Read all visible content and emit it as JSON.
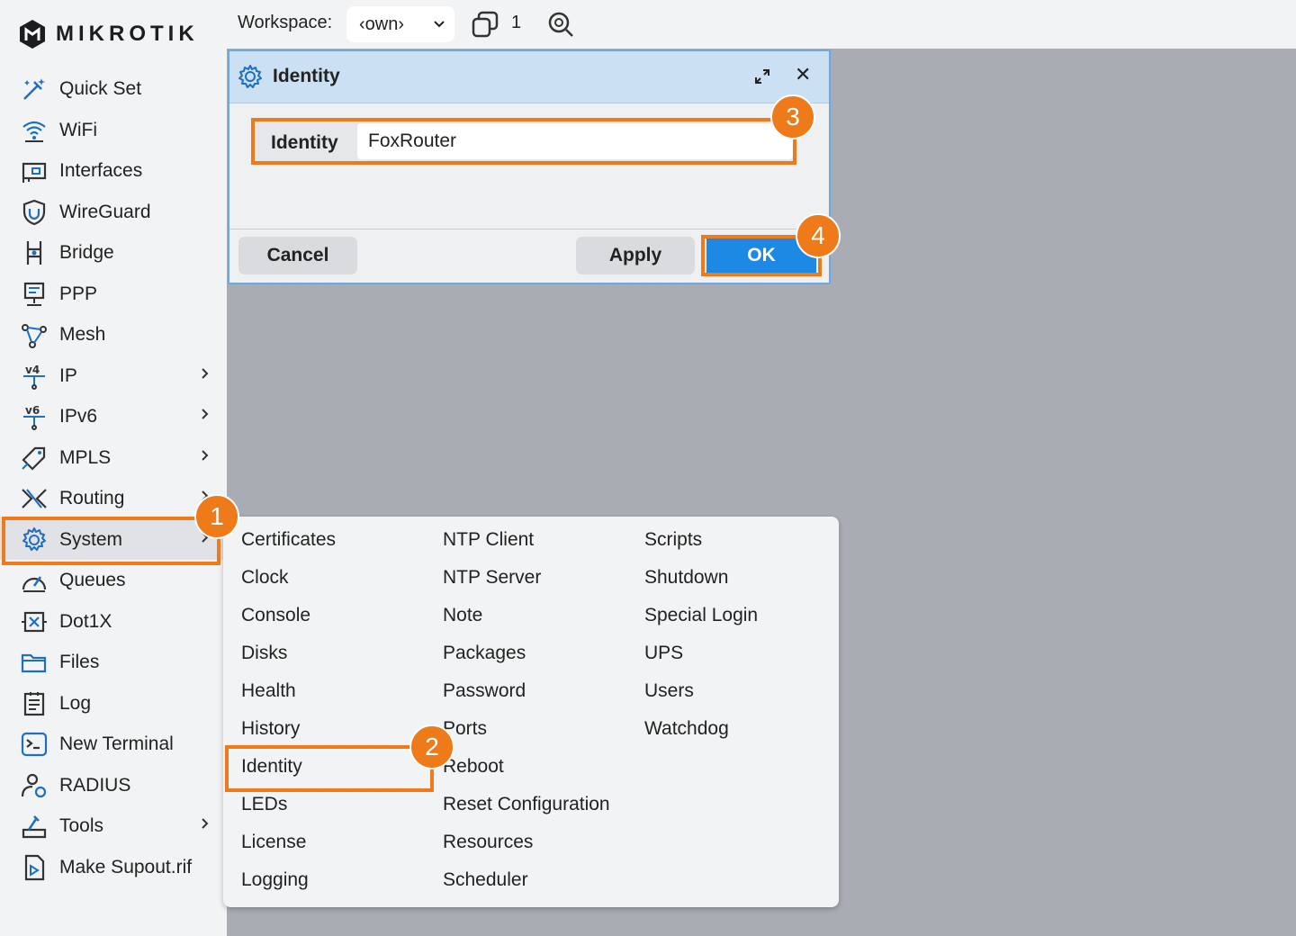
{
  "brand": {
    "logo_text": "MIKROTIK"
  },
  "sidebar": {
    "items": [
      {
        "label": "Quick Set",
        "icon": "magic-wand-icon",
        "has_submenu": false
      },
      {
        "label": "WiFi",
        "icon": "wifi-icon",
        "has_submenu": false
      },
      {
        "label": "Interfaces",
        "icon": "interfaces-icon",
        "has_submenu": false
      },
      {
        "label": "WireGuard",
        "icon": "shield-icon",
        "has_submenu": false
      },
      {
        "label": "Bridge",
        "icon": "bridge-icon",
        "has_submenu": false
      },
      {
        "label": "PPP",
        "icon": "ppp-icon",
        "has_submenu": false
      },
      {
        "label": "Mesh",
        "icon": "mesh-icon",
        "has_submenu": false
      },
      {
        "label": "IP",
        "icon": "ipv4-icon",
        "has_submenu": true
      },
      {
        "label": "IPv6",
        "icon": "ipv6-icon",
        "has_submenu": true
      },
      {
        "label": "MPLS",
        "icon": "tag-icon",
        "has_submenu": true
      },
      {
        "label": "Routing",
        "icon": "routing-icon",
        "has_submenu": true
      },
      {
        "label": "System",
        "icon": "gear-icon",
        "has_submenu": true
      },
      {
        "label": "Queues",
        "icon": "gauge-icon",
        "has_submenu": false
      },
      {
        "label": "Dot1X",
        "icon": "dot1x-icon",
        "has_submenu": false
      },
      {
        "label": "Files",
        "icon": "folder-icon",
        "has_submenu": false
      },
      {
        "label": "Log",
        "icon": "log-icon",
        "has_submenu": false
      },
      {
        "label": "New Terminal",
        "icon": "terminal-icon",
        "has_submenu": false
      },
      {
        "label": "RADIUS",
        "icon": "user-gear-icon",
        "has_submenu": false
      },
      {
        "label": "Tools",
        "icon": "tools-icon",
        "has_submenu": true
      },
      {
        "label": "Make Supout.rif",
        "icon": "file-play-icon",
        "has_submenu": false
      }
    ],
    "chevron": ">"
  },
  "topbar": {
    "workspace_label": "Workspace:",
    "workspace_value": "‹own›",
    "window_count": "1"
  },
  "dialog": {
    "title": "Identity",
    "field_label": "Identity",
    "field_value": "FoxRouter",
    "cancel_label": "Cancel",
    "apply_label": "Apply",
    "ok_label": "OK"
  },
  "system_menu": {
    "columns": [
      [
        "Certificates",
        "Clock",
        "Console",
        "Disks",
        "Health",
        "History",
        "Identity",
        "LEDs",
        "License",
        "Logging"
      ],
      [
        "NTP Client",
        "NTP Server",
        "Note",
        "Packages",
        "Password",
        "Ports",
        "Reboot",
        "Reset Configuration",
        "Resources",
        "Scheduler"
      ],
      [
        "Scripts",
        "Shutdown",
        "Special Login",
        "UPS",
        "Users",
        "Watchdog"
      ]
    ]
  },
  "steps": [
    "1",
    "2",
    "3",
    "4"
  ],
  "colors": {
    "highlight": "#ee7a1a",
    "ok_button": "#1e88e5",
    "title_bar": "#cbe0f3",
    "workspace_bg": "#a9adb3"
  }
}
